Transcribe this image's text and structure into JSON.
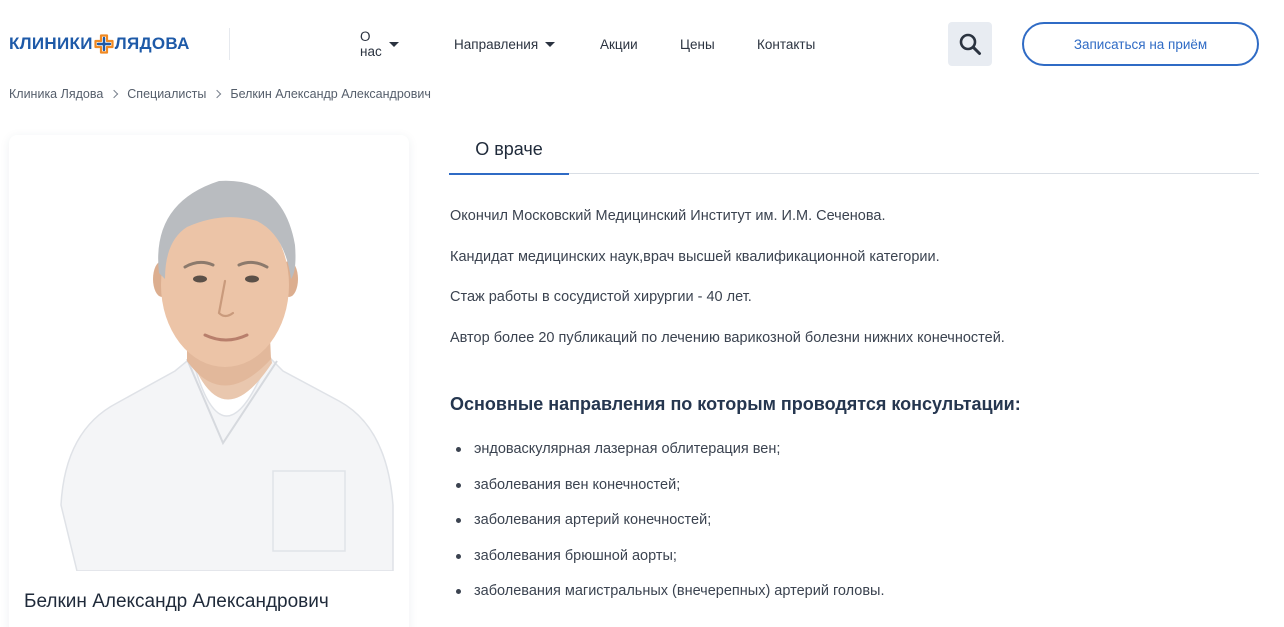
{
  "header": {
    "logo": {
      "left_word": "КЛИНИКИ",
      "right_word": "ЛЯДОВА"
    },
    "nav": [
      {
        "label": "О нас",
        "has_dropdown": true
      },
      {
        "label": "Направления",
        "has_dropdown": true
      },
      {
        "label": "Акции",
        "has_dropdown": false
      },
      {
        "label": "Цены",
        "has_dropdown": false
      },
      {
        "label": "Контакты",
        "has_dropdown": false
      }
    ],
    "search_icon": "search-icon",
    "cta_label": "Записаться на приём"
  },
  "breadcrumb": [
    "Клиника Лядова",
    "Специалисты",
    "Белкин Александр Александрович"
  ],
  "doctor": {
    "name": "Белкин Александр Александрович"
  },
  "tabs": [
    {
      "label": "О враче",
      "active": true
    }
  ],
  "about": [
    "Окончил Московский Медицинский Институт им. И.М. Сеченова.",
    "Кандидат медицинских наук,врач высшей квалификационной категории.",
    "Стаж работы в сосудистой хирургии - 40 лет.",
    "Автор более 20 публикаций по лечению варикозной болезни нижних конечностей."
  ],
  "directions": {
    "title": "Основные направления по которым проводятся консультации:",
    "items": [
      "эндоваскулярная лазерная облитерация вен;",
      "заболевания вен конечностей;",
      "заболевания артерий конечностей;",
      "заболевания брюшной аорты;",
      "заболевания магистральных (внечерепных) артерий головы."
    ]
  },
  "colors": {
    "brand_blue": "#1e5aa8",
    "accent_blue": "#2f6bc5",
    "logo_orange": "#f08a24",
    "heading": "#25364f"
  }
}
